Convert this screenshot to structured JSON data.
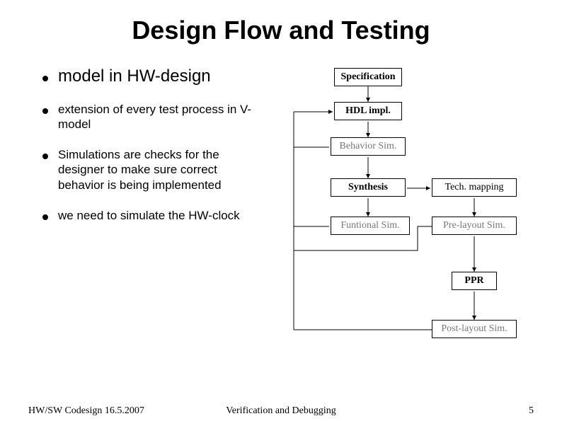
{
  "title": "Design Flow and Testing",
  "bullets": {
    "b1": "model in HW-design",
    "b2": "extension of every test process in V-model",
    "b3": "Simulations are checks for the designer to make sure correct behavior is being implemented",
    "b4": "we need to simulate the HW-clock"
  },
  "diagram": {
    "spec": "Specification",
    "hdl": "HDL impl.",
    "bsim": "Behavior Sim.",
    "synth": "Synthesis",
    "tech": "Tech. mapping",
    "fsim": "Funtional Sim.",
    "psim": "Pre-layout Sim.",
    "ppr": "PPR",
    "postsim": "Post-layout Sim."
  },
  "footer": {
    "left": "HW/SW Codesign 16.5.2007",
    "center": "Verification and Debugging",
    "right": "5"
  }
}
